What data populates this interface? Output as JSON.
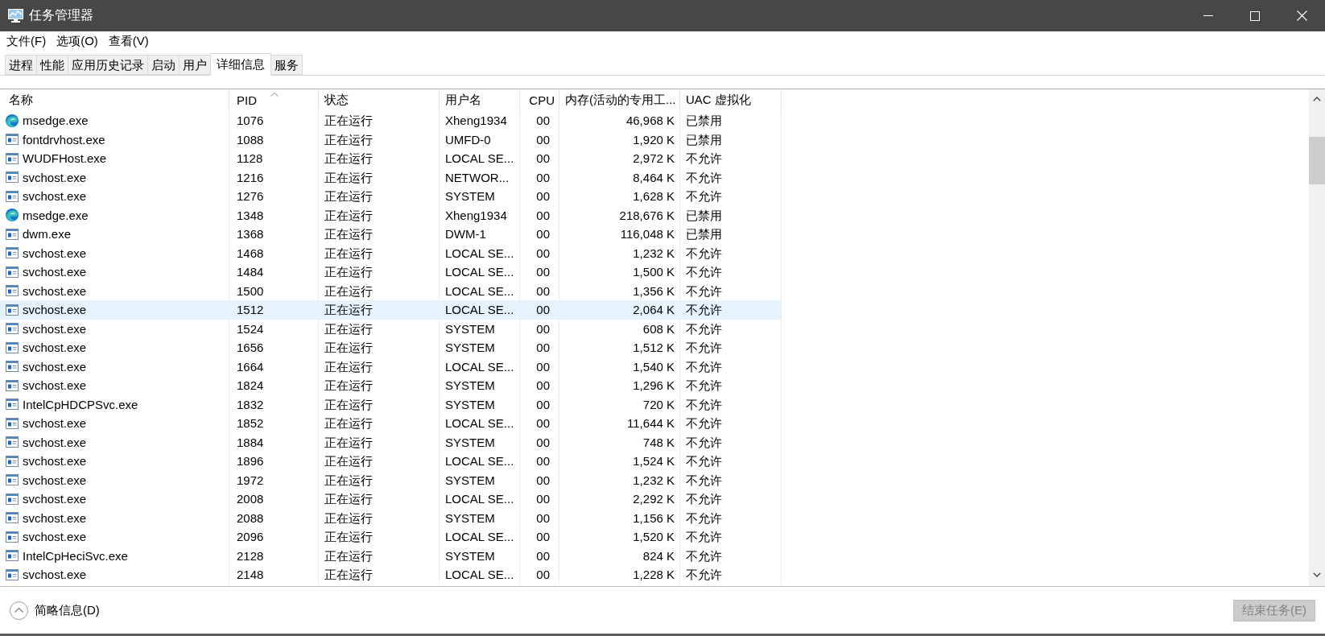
{
  "window": {
    "title": "任务管理器"
  },
  "menu": [
    "文件(F)",
    "选项(O)",
    "查看(V)"
  ],
  "tabs": [
    {
      "label": "进程",
      "selected": false
    },
    {
      "label": "性能",
      "selected": false
    },
    {
      "label": "应用历史记录",
      "selected": false
    },
    {
      "label": "启动",
      "selected": false
    },
    {
      "label": "用户",
      "selected": false
    },
    {
      "label": "详细信息",
      "selected": true
    },
    {
      "label": "服务",
      "selected": false
    }
  ],
  "table": {
    "columns": [
      {
        "label": "名称",
        "sorted": false
      },
      {
        "label": "PID",
        "sorted": true
      },
      {
        "label": "状态",
        "sorted": false
      },
      {
        "label": "用户名",
        "sorted": false
      },
      {
        "label": "CPU",
        "sorted": false
      },
      {
        "label": "内存(活动的专用工...",
        "sorted": false
      },
      {
        "label": "UAC 虚拟化",
        "sorted": false
      }
    ],
    "rows": [
      {
        "kind": "browser",
        "name": "msedge.exe",
        "pid": "1076",
        "status": "正在运行",
        "user": "Xheng1934",
        "cpu": "00",
        "memory": "46,968 K",
        "uac": "已禁用",
        "selected": false
      },
      {
        "kind": "program",
        "name": "fontdrvhost.exe",
        "pid": "1088",
        "status": "正在运行",
        "user": "UMFD-0",
        "cpu": "00",
        "memory": "1,920 K",
        "uac": "已禁用",
        "selected": false
      },
      {
        "kind": "program",
        "name": "WUDFHost.exe",
        "pid": "1128",
        "status": "正在运行",
        "user": "LOCAL SE...",
        "cpu": "00",
        "memory": "2,972 K",
        "uac": "不允许",
        "selected": false
      },
      {
        "kind": "program",
        "name": "svchost.exe",
        "pid": "1216",
        "status": "正在运行",
        "user": "NETWOR...",
        "cpu": "00",
        "memory": "8,464 K",
        "uac": "不允许",
        "selected": false
      },
      {
        "kind": "program",
        "name": "svchost.exe",
        "pid": "1276",
        "status": "正在运行",
        "user": "SYSTEM",
        "cpu": "00",
        "memory": "1,628 K",
        "uac": "不允许",
        "selected": false
      },
      {
        "kind": "browser",
        "name": "msedge.exe",
        "pid": "1348",
        "status": "正在运行",
        "user": "Xheng1934",
        "cpu": "00",
        "memory": "218,676 K",
        "uac": "已禁用",
        "selected": false
      },
      {
        "kind": "program",
        "name": "dwm.exe",
        "pid": "1368",
        "status": "正在运行",
        "user": "DWM-1",
        "cpu": "00",
        "memory": "116,048 K",
        "uac": "已禁用",
        "selected": false
      },
      {
        "kind": "program",
        "name": "svchost.exe",
        "pid": "1468",
        "status": "正在运行",
        "user": "LOCAL SE...",
        "cpu": "00",
        "memory": "1,232 K",
        "uac": "不允许",
        "selected": false
      },
      {
        "kind": "program",
        "name": "svchost.exe",
        "pid": "1484",
        "status": "正在运行",
        "user": "LOCAL SE...",
        "cpu": "00",
        "memory": "1,500 K",
        "uac": "不允许",
        "selected": false
      },
      {
        "kind": "program",
        "name": "svchost.exe",
        "pid": "1500",
        "status": "正在运行",
        "user": "LOCAL SE...",
        "cpu": "00",
        "memory": "1,356 K",
        "uac": "不允许",
        "selected": false
      },
      {
        "kind": "program",
        "name": "svchost.exe",
        "pid": "1512",
        "status": "正在运行",
        "user": "LOCAL SE...",
        "cpu": "00",
        "memory": "2,064 K",
        "uac": "不允许",
        "selected": true
      },
      {
        "kind": "program",
        "name": "svchost.exe",
        "pid": "1524",
        "status": "正在运行",
        "user": "SYSTEM",
        "cpu": "00",
        "memory": "608 K",
        "uac": "不允许",
        "selected": false
      },
      {
        "kind": "program",
        "name": "svchost.exe",
        "pid": "1656",
        "status": "正在运行",
        "user": "SYSTEM",
        "cpu": "00",
        "memory": "1,512 K",
        "uac": "不允许",
        "selected": false
      },
      {
        "kind": "program",
        "name": "svchost.exe",
        "pid": "1664",
        "status": "正在运行",
        "user": "LOCAL SE...",
        "cpu": "00",
        "memory": "1,540 K",
        "uac": "不允许",
        "selected": false
      },
      {
        "kind": "program",
        "name": "svchost.exe",
        "pid": "1824",
        "status": "正在运行",
        "user": "SYSTEM",
        "cpu": "00",
        "memory": "1,296 K",
        "uac": "不允许",
        "selected": false
      },
      {
        "kind": "program",
        "name": "IntelCpHDCPSvc.exe",
        "pid": "1832",
        "status": "正在运行",
        "user": "SYSTEM",
        "cpu": "00",
        "memory": "720 K",
        "uac": "不允许",
        "selected": false
      },
      {
        "kind": "program",
        "name": "svchost.exe",
        "pid": "1852",
        "status": "正在运行",
        "user": "LOCAL SE...",
        "cpu": "00",
        "memory": "11,644 K",
        "uac": "不允许",
        "selected": false
      },
      {
        "kind": "program",
        "name": "svchost.exe",
        "pid": "1884",
        "status": "正在运行",
        "user": "SYSTEM",
        "cpu": "00",
        "memory": "748 K",
        "uac": "不允许",
        "selected": false
      },
      {
        "kind": "program",
        "name": "svchost.exe",
        "pid": "1896",
        "status": "正在运行",
        "user": "LOCAL SE...",
        "cpu": "00",
        "memory": "1,524 K",
        "uac": "不允许",
        "selected": false
      },
      {
        "kind": "program",
        "name": "svchost.exe",
        "pid": "1972",
        "status": "正在运行",
        "user": "SYSTEM",
        "cpu": "00",
        "memory": "1,232 K",
        "uac": "不允许",
        "selected": false
      },
      {
        "kind": "program",
        "name": "svchost.exe",
        "pid": "2008",
        "status": "正在运行",
        "user": "LOCAL SE...",
        "cpu": "00",
        "memory": "2,292 K",
        "uac": "不允许",
        "selected": false
      },
      {
        "kind": "program",
        "name": "svchost.exe",
        "pid": "2088",
        "status": "正在运行",
        "user": "SYSTEM",
        "cpu": "00",
        "memory": "1,156 K",
        "uac": "不允许",
        "selected": false
      },
      {
        "kind": "program",
        "name": "svchost.exe",
        "pid": "2096",
        "status": "正在运行",
        "user": "LOCAL SE...",
        "cpu": "00",
        "memory": "1,520 K",
        "uac": "不允许",
        "selected": false
      },
      {
        "kind": "program",
        "name": "IntelCpHeciSvc.exe",
        "pid": "2128",
        "status": "正在运行",
        "user": "SYSTEM",
        "cpu": "00",
        "memory": "824 K",
        "uac": "不允许",
        "selected": false
      },
      {
        "kind": "program",
        "name": "svchost.exe",
        "pid": "2148",
        "status": "正在运行",
        "user": "LOCAL SE...",
        "cpu": "00",
        "memory": "1,228 K",
        "uac": "不允许",
        "selected": false
      }
    ]
  },
  "footer": {
    "details_toggle": "简略信息(D)",
    "end_task": {
      "label": "结束任务(E)",
      "disabled": true
    }
  }
}
